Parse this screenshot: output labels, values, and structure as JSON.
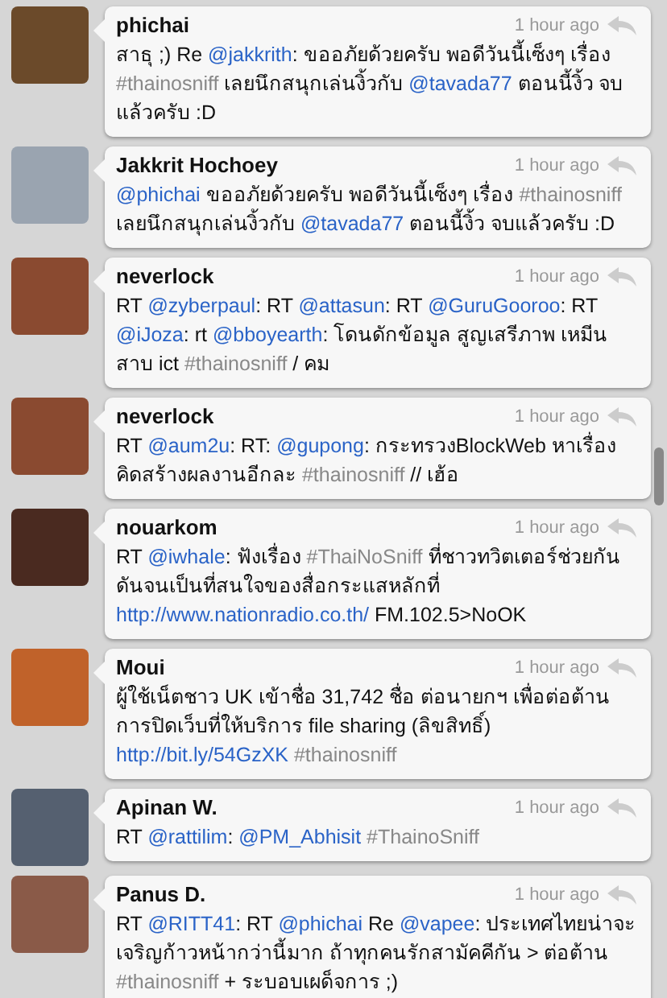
{
  "tweets": [
    {
      "user": "phichai",
      "time": "1 hour ago",
      "body": [
        {
          "kind": "text",
          "text": "สาธุ ;) Re "
        },
        {
          "kind": "mention",
          "text": "@jakkrith"
        },
        {
          "kind": "text",
          "text": ": ขออภัยด้วยครับ พอดีวันนี้เซ็งๆ เรื่อง "
        },
        {
          "kind": "hashtag",
          "text": "#thainosniff"
        },
        {
          "kind": "text",
          "text": " เลยนึกสนุกเล่นงิ้วกับ "
        },
        {
          "kind": "mention",
          "text": "@tavada77"
        },
        {
          "kind": "text",
          "text": " ตอนนี้งิ้ว จบแล้วครับ :D"
        }
      ]
    },
    {
      "user": "Jakkrit Hochoey",
      "time": "1 hour ago",
      "body": [
        {
          "kind": "mention",
          "text": "@phichai"
        },
        {
          "kind": "text",
          "text": " ขออภัยด้วยครับ พอดีวันนี้เซ็งๆ เรื่อง "
        },
        {
          "kind": "hashtag",
          "text": "#thainosniff"
        },
        {
          "kind": "text",
          "text": " เลยนึกสนุกเล่นงิ้วกับ "
        },
        {
          "kind": "mention",
          "text": "@tavada77"
        },
        {
          "kind": "text",
          "text": " ตอนนี้งิ้ว จบแล้วครับ :D"
        }
      ]
    },
    {
      "user": "neverlock",
      "time": "1 hour ago",
      "body": [
        {
          "kind": "text",
          "text": "RT "
        },
        {
          "kind": "mention",
          "text": "@zyberpaul"
        },
        {
          "kind": "text",
          "text": ": RT "
        },
        {
          "kind": "mention",
          "text": "@attasun"
        },
        {
          "kind": "text",
          "text": ": RT "
        },
        {
          "kind": "mention",
          "text": "@GuruGooroo"
        },
        {
          "kind": "text",
          "text": ": RT "
        },
        {
          "kind": "mention",
          "text": "@iJoza"
        },
        {
          "kind": "text",
          "text": ": rt "
        },
        {
          "kind": "mention",
          "text": "@bboyearth"
        },
        {
          "kind": "text",
          "text": ": โดนดักข้อมูล สูญเสรีภาพ เหมีนสาบ ict "
        },
        {
          "kind": "hashtag",
          "text": "#thainosniff"
        },
        {
          "kind": "text",
          "text": " / คม"
        }
      ]
    },
    {
      "user": "neverlock",
      "time": "1 hour ago",
      "body": [
        {
          "kind": "text",
          "text": "RT "
        },
        {
          "kind": "mention",
          "text": "@aum2u"
        },
        {
          "kind": "text",
          "text": ": RT: "
        },
        {
          "kind": "mention",
          "text": "@gupong"
        },
        {
          "kind": "text",
          "text": ": กระทรวงBlockWeb หาเรื่องคิดสร้างผลงานอีกละ "
        },
        {
          "kind": "hashtag",
          "text": "#thainosniff"
        },
        {
          "kind": "text",
          "text": "  // เฮ้อ"
        }
      ]
    },
    {
      "user": "nouarkom",
      "time": "1 hour ago",
      "body": [
        {
          "kind": "text",
          "text": "RT "
        },
        {
          "kind": "mention",
          "text": "@iwhale"
        },
        {
          "kind": "text",
          "text": ": ฟังเรื่อง "
        },
        {
          "kind": "hashtag",
          "text": "#ThaiNoSniff"
        },
        {
          "kind": "text",
          "text": " ที่ชาวทวิตเตอร์ช่วยกันดันจนเป็นที่สนใจของสื่อกระแสหลักที่ "
        },
        {
          "kind": "link",
          "text": "http://www.nationradio.co.th/"
        },
        {
          "kind": "text",
          "text": " FM.102.5>NoOK"
        }
      ]
    },
    {
      "user": "Moui",
      "time": "1 hour ago",
      "body": [
        {
          "kind": "text",
          "text": "ผู้ใช้เน็ตชาว UK เข้าชื่อ 31,742 ชื่อ ต่อนายกฯ เพื่อต่อต้านการปิดเว็บที่ให้บริการ file sharing (ลิขสิทธิ์) "
        },
        {
          "kind": "link",
          "text": "http://bit.ly/54GzXK"
        },
        {
          "kind": "hashtag",
          "text": "#thainosniff",
          "gap": true
        }
      ]
    },
    {
      "user": "Apinan W.",
      "time": "1 hour ago",
      "body": [
        {
          "kind": "text",
          "text": "RT "
        },
        {
          "kind": "mention",
          "text": "@rattilim"
        },
        {
          "kind": "text",
          "text": ": "
        },
        {
          "kind": "mention",
          "text": "@PM_Abhisit"
        },
        {
          "kind": "hashtag",
          "text": "#ThainoSniff",
          "gap": true
        }
      ]
    },
    {
      "user": "Panus D.",
      "time": "1 hour ago",
      "body": [
        {
          "kind": "text",
          "text": "RT "
        },
        {
          "kind": "mention",
          "text": "@RITT41"
        },
        {
          "kind": "text",
          "text": ": RT "
        },
        {
          "kind": "mention",
          "text": "@phichai"
        },
        {
          "kind": "text",
          "text": " Re "
        },
        {
          "kind": "mention",
          "text": "@vapee"
        },
        {
          "kind": "text",
          "text": ": ประเทศไทยน่าจะเจริญก้าวหน้ากว่านี้มาก ถ้าทุกคนรักสามัคคีกัน > ต่อต้าน "
        },
        {
          "kind": "hashtag",
          "text": "#thainosniff"
        },
        {
          "kind": "text",
          "text": "  + ระบอบเผด็จการ ;)"
        }
      ]
    }
  ]
}
